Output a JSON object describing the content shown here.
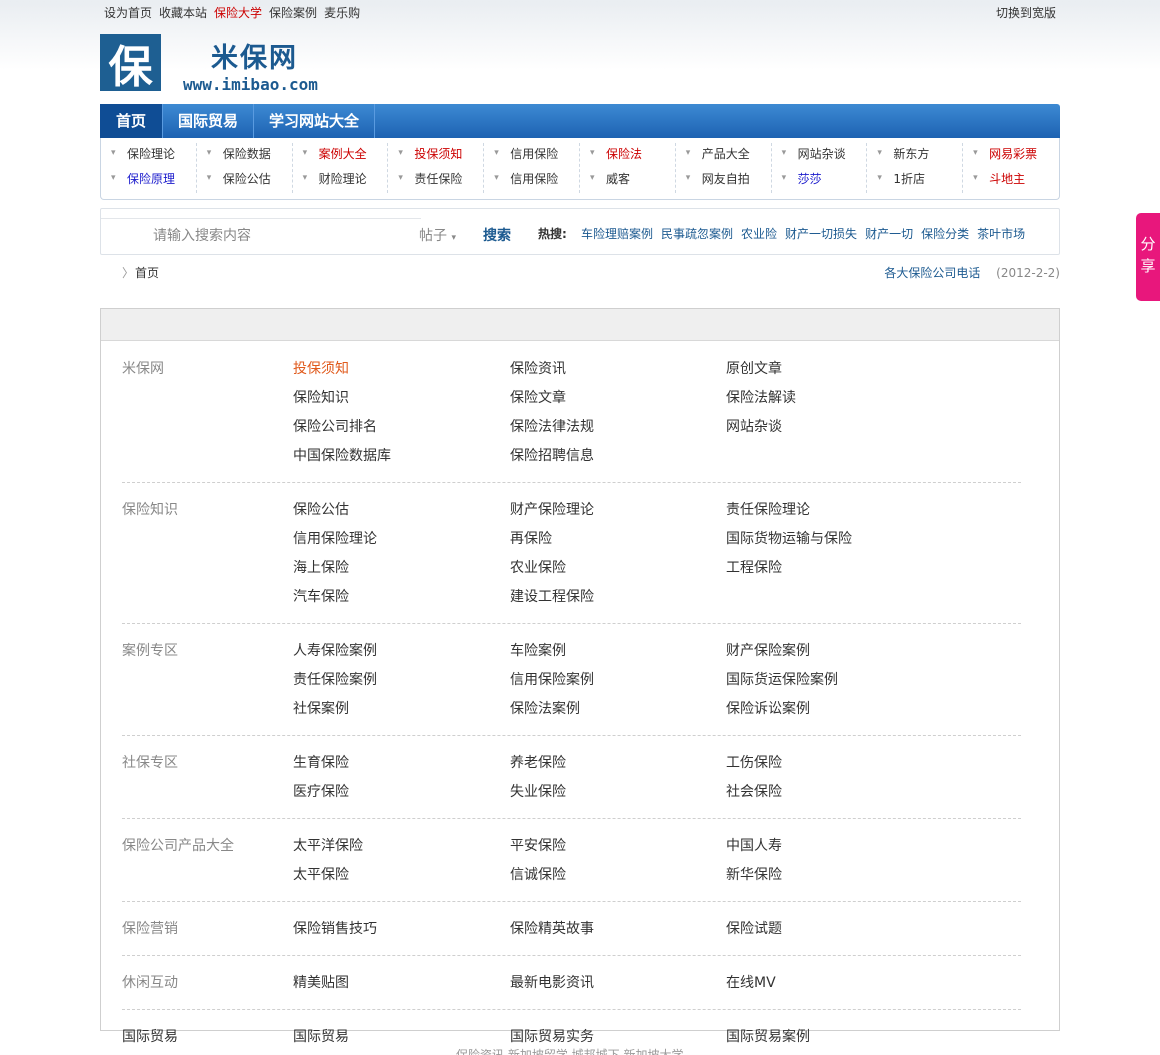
{
  "topbar": {
    "links": [
      "设为首页",
      "收藏本站",
      "保险大学",
      "保险案例",
      "麦乐购"
    ],
    "highlight_index": 2,
    "right": "切换到宽版"
  },
  "logo": {
    "char": "保",
    "name": "米保网",
    "url": "www.imibao.com"
  },
  "mainnav": [
    "首页",
    "国际贸易",
    "学习网站大全"
  ],
  "subnav": [
    [
      {
        "t": "保险理论",
        "c": ""
      },
      {
        "t": "保险原理",
        "c": "blue"
      }
    ],
    [
      {
        "t": "保险数据",
        "c": ""
      },
      {
        "t": "保险公估",
        "c": ""
      }
    ],
    [
      {
        "t": "案例大全",
        "c": "red"
      },
      {
        "t": "财险理论",
        "c": ""
      }
    ],
    [
      {
        "t": "投保须知",
        "c": "red"
      },
      {
        "t": "责任保险",
        "c": ""
      }
    ],
    [
      {
        "t": "信用保险",
        "c": ""
      },
      {
        "t": "信用保险",
        "c": ""
      }
    ],
    [
      {
        "t": "保险法",
        "c": "red"
      },
      {
        "t": "威客",
        "c": ""
      }
    ],
    [
      {
        "t": "产品大全",
        "c": ""
      },
      {
        "t": "网友自拍",
        "c": ""
      }
    ],
    [
      {
        "t": "网站杂谈",
        "c": ""
      },
      {
        "t": "莎莎",
        "c": "blue"
      }
    ],
    [
      {
        "t": "新东方",
        "c": ""
      },
      {
        "t": "1折店",
        "c": ""
      }
    ],
    [
      {
        "t": "网易彩票",
        "c": "red"
      },
      {
        "t": "斗地主",
        "c": "red"
      }
    ]
  ],
  "search": {
    "placeholder": "请输入搜索内容",
    "type": "帖子",
    "button": "搜索",
    "hot_label": "热搜:",
    "hot": [
      "车险理赔案例",
      "民事疏忽案例",
      "农业险",
      "财产一切损失",
      "财产一切",
      "保险分类",
      "茶叶市场"
    ]
  },
  "breadcrumb": {
    "home": "首页",
    "tel": "各大保险公司电话",
    "date": "(2012-2-2)"
  },
  "sections": [
    {
      "cat": "米保网",
      "links": [
        "投保须知",
        "保险资讯",
        "原创文章",
        "保险知识",
        "保险文章",
        "保险法解读",
        "保险公司排名",
        "保险法律法规",
        "网站杂谈",
        "中国保险数据库",
        "保险招聘信息"
      ]
    },
    {
      "cat": "保险知识",
      "links": [
        "保险公估",
        "财产保险理论",
        "责任保险理论",
        "信用保险理论",
        "再保险",
        "国际货物运输与保险",
        "海上保险",
        "农业保险",
        "工程保险",
        "汽车保险",
        "建设工程保险"
      ]
    },
    {
      "cat": "案例专区",
      "links": [
        "人寿保险案例",
        "车险案例",
        "财产保险案例",
        "责任保险案例",
        "信用保险案例",
        "国际货运保险案例",
        "社保案例",
        "保险法案例",
        "保险诉讼案例"
      ]
    },
    {
      "cat": "社保专区",
      "links": [
        "生育保险",
        "养老保险",
        "工伤保险",
        "医疗保险",
        "失业保险",
        "社会保险"
      ]
    },
    {
      "cat": "保险公司产品大全",
      "links": [
        "太平洋保险",
        "平安保险",
        "中国人寿",
        "太平保险",
        "信诚保险",
        "新华保险"
      ]
    },
    {
      "cat": "保险营销",
      "links": [
        "保险销售技巧",
        "保险精英故事",
        "保险试题"
      ]
    },
    {
      "cat": "休闲互动",
      "links": [
        "精美贴图",
        "最新电影资讯",
        "在线MV"
      ]
    },
    {
      "cat": "国际贸易",
      "links": [
        "国际贸易",
        "国际贸易实务",
        "国际贸易案例"
      ]
    }
  ],
  "footer": "保险资讯 新加坡留学 城邦城下 新加坡大学",
  "share": [
    "分",
    "享"
  ]
}
